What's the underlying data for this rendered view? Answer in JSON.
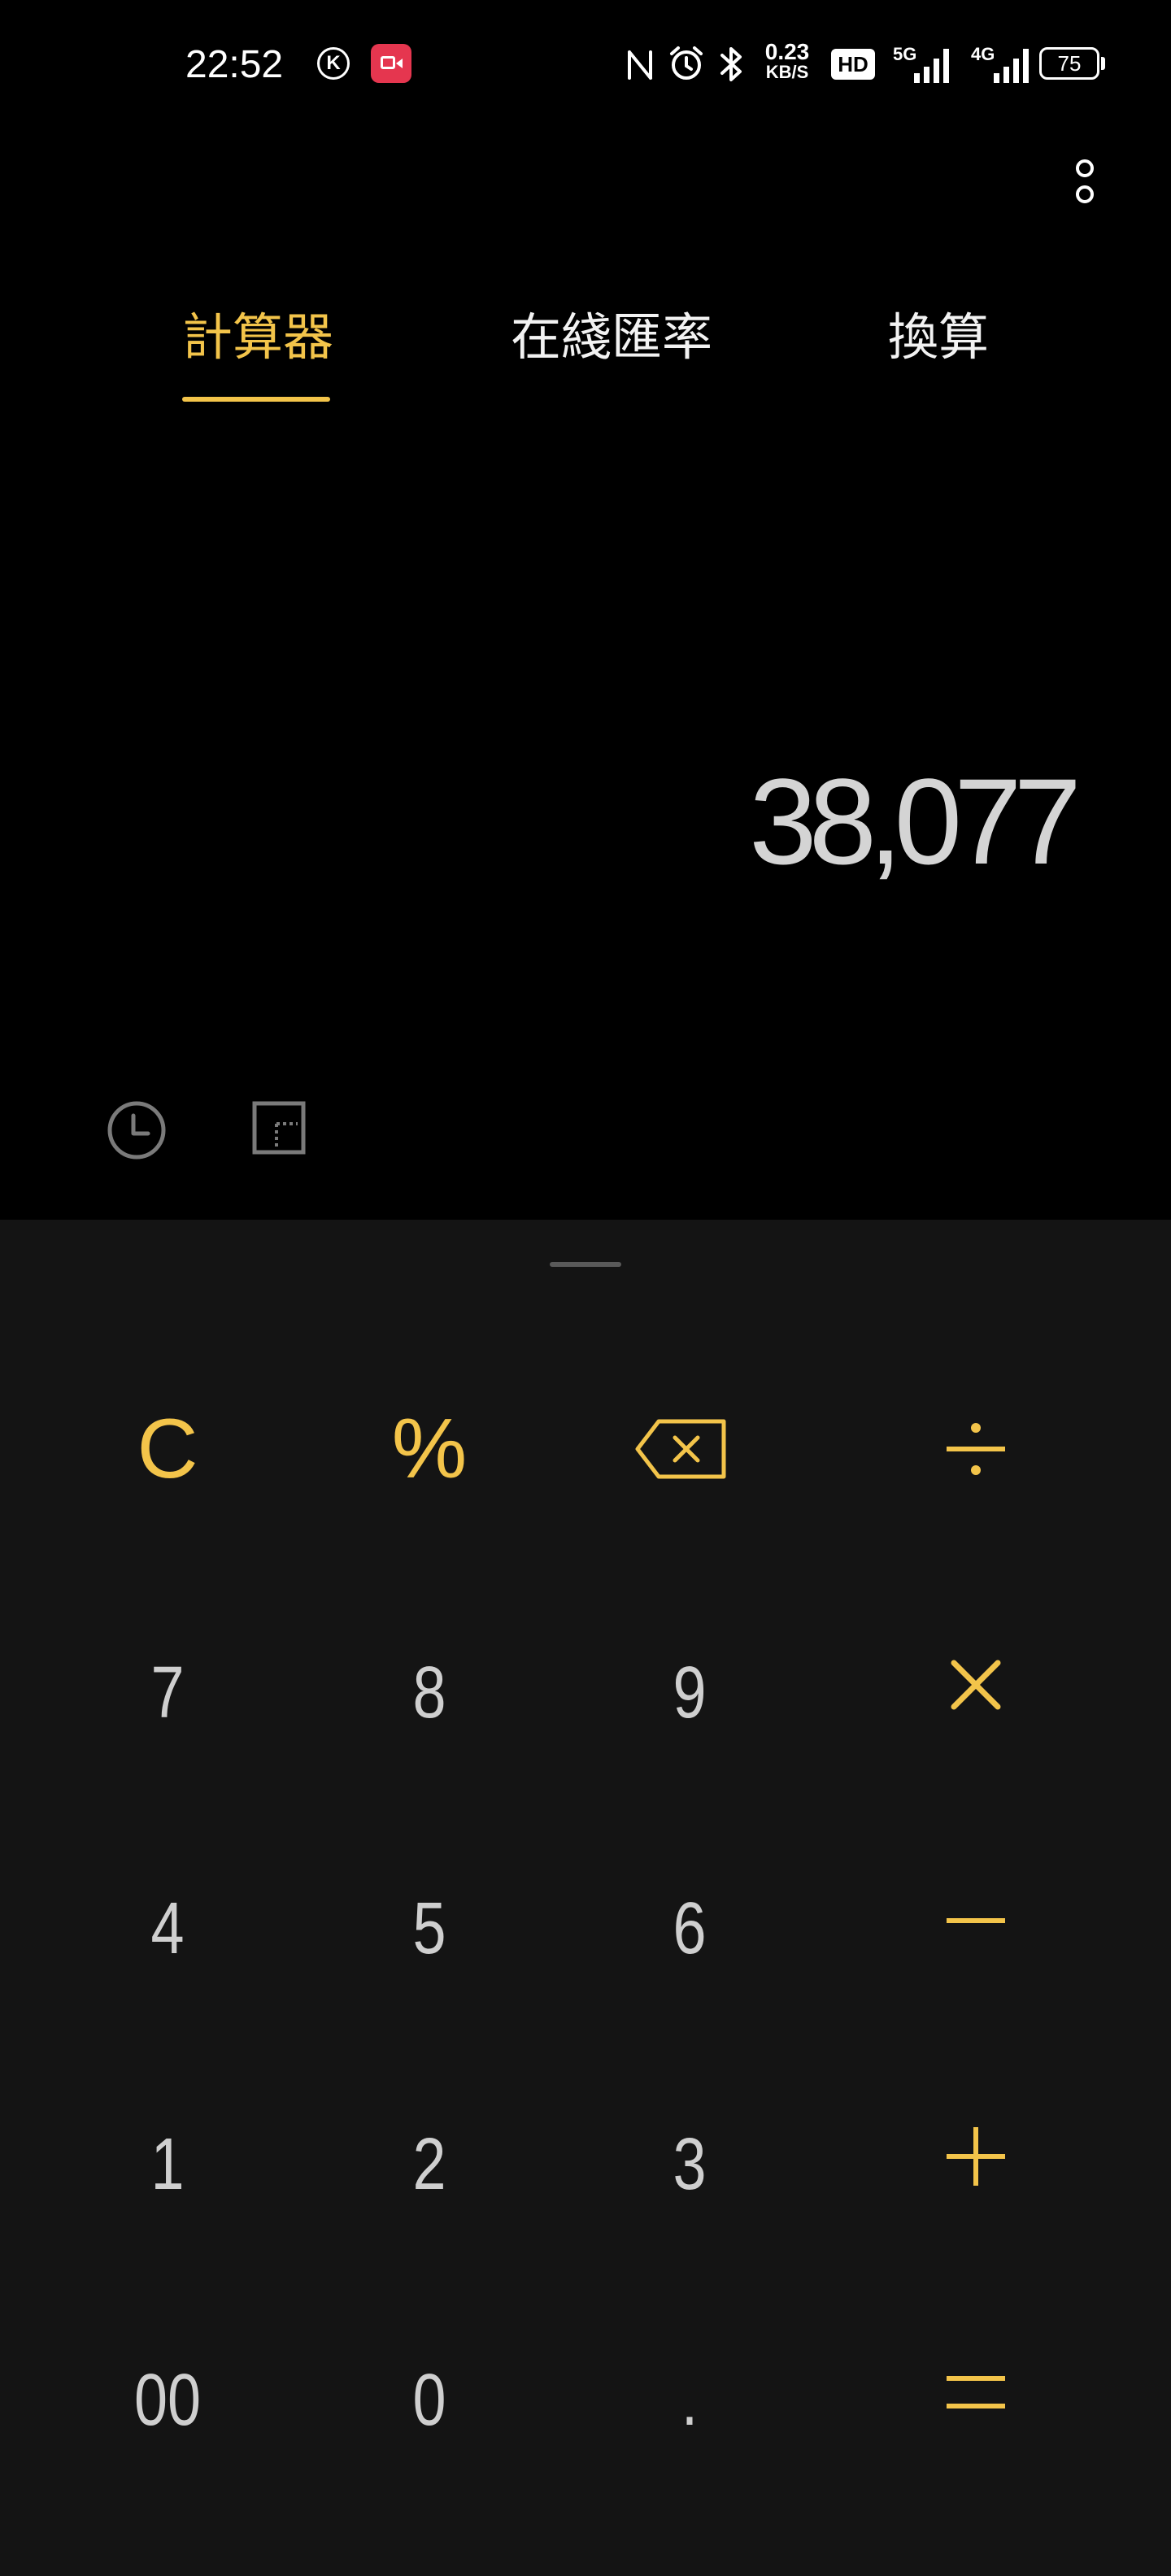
{
  "status_bar": {
    "time": "22:52",
    "k_badge": "K",
    "net_speed_value": "0.23",
    "net_speed_unit": "KB/S",
    "hd_label": "HD",
    "signal_1_label": "5G",
    "signal_2_label": "4G",
    "battery_level": "75",
    "icons": [
      "k-icon",
      "screen-record-icon",
      "nfc-icon",
      "alarm-icon",
      "bluetooth-icon",
      "hd-voice-icon",
      "signal-5g-icon",
      "signal-4g-icon",
      "battery-icon"
    ]
  },
  "tabs": [
    {
      "label": "計算器",
      "active": true
    },
    {
      "label": "在綫匯率",
      "active": false
    },
    {
      "label": "換算",
      "active": false
    }
  ],
  "display": {
    "value": "38,077"
  },
  "tools": {
    "icons": [
      "history-icon",
      "scientific-toggle-icon"
    ]
  },
  "keypad": {
    "accent_color": "#f3c44a",
    "digit_color": "#cfcfcf",
    "rows": [
      [
        "C",
        "%",
        "backspace",
        "÷"
      ],
      [
        "7",
        "8",
        "9",
        "×"
      ],
      [
        "4",
        "5",
        "6",
        "−"
      ],
      [
        "1",
        "2",
        "3",
        "+"
      ],
      [
        "00",
        "0",
        ".",
        "="
      ]
    ]
  }
}
